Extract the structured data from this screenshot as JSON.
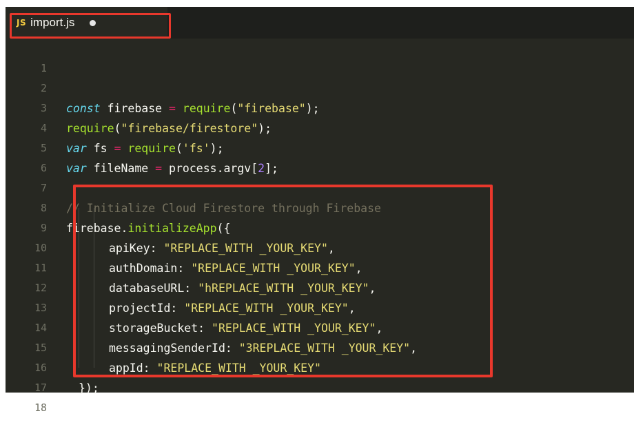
{
  "tab": {
    "icon_label": "JS",
    "file_name": "import.js"
  },
  "colors": {
    "editor_bg": "#272822",
    "highlight_border": "#e8382c",
    "keyword": "#66d9ef",
    "function": "#a6e22e",
    "string": "#e6db74",
    "operator": "#f92672",
    "number": "#ae81ff",
    "comment": "#75715e"
  },
  "code": {
    "line_numbers": [
      "1",
      "2",
      "3",
      "4",
      "5",
      "6",
      "7",
      "8",
      "9",
      "10",
      "11",
      "12",
      "13",
      "14",
      "15",
      "16",
      "17",
      "18"
    ],
    "l2": {
      "kw": "const",
      "a": " firebase ",
      "op": "=",
      "b": " ",
      "fn": "require",
      "c": "(",
      "str": "\"firebase\"",
      "d": ");"
    },
    "l3": {
      "fn": "require",
      "a": "(",
      "str": "\"firebase/firestore\"",
      "b": ");"
    },
    "l4": {
      "kw": "var",
      "a": " fs ",
      "op": "=",
      "b": " ",
      "fn": "require",
      "c": "(",
      "str": "'fs'",
      "d": ");"
    },
    "l5": {
      "kw": "var",
      "a": " fileName ",
      "op": "=",
      "b": " process.argv[",
      "num": "2",
      "c": "];"
    },
    "l7": {
      "comment": "// Initialize Cloud Firestore through Firebase"
    },
    "l8": {
      "a": "firebase.",
      "fn": "initializeApp",
      "b": "({"
    },
    "config": [
      {
        "key": "apiKey: ",
        "value": "\"REPLACE_WITH _YOUR_KEY\"",
        "comma": ","
      },
      {
        "key": "authDomain: ",
        "value": "\"REPLACE_WITH _YOUR_KEY\"",
        "comma": ","
      },
      {
        "key": "databaseURL: ",
        "value": "\"hREPLACE_WITH _YOUR_KEY\"",
        "comma": ","
      },
      {
        "key": "projectId: ",
        "value": "\"REPLACE_WITH _YOUR_KEY\"",
        "comma": ","
      },
      {
        "key": "storageBucket: ",
        "value": "\"REPLACE_WITH _YOUR_KEY\"",
        "comma": ","
      },
      {
        "key": "messagingSenderId: ",
        "value": "\"3REPLACE_WITH _YOUR_KEY\"",
        "comma": ","
      },
      {
        "key": "appId: ",
        "value": "\"REPLACE_WITH _YOUR_KEY\"",
        "comma": ""
      }
    ],
    "l16": {
      "a": "});"
    }
  }
}
